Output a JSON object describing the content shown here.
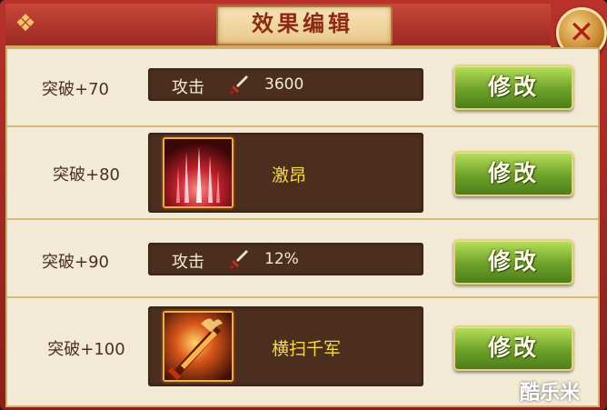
{
  "dialog": {
    "title": "效果编辑",
    "close_glyph": "✕",
    "corner_glyph": "❖"
  },
  "rows": [
    {
      "label": "突破+70",
      "kind": "stat",
      "attribute": "攻击",
      "icon": "sword-icon",
      "value": "3600",
      "button": "修改"
    },
    {
      "label": "突破+80",
      "kind": "skill",
      "skill_name": "激昂",
      "icon": "light-beams-skill-icon",
      "button": "修改"
    },
    {
      "label": "突破+90",
      "kind": "stat",
      "attribute": "攻击",
      "icon": "sword-icon",
      "value": "12%",
      "button": "修改"
    },
    {
      "label": "突破+100",
      "kind": "skill",
      "skill_name": "横扫千军",
      "icon": "flaming-sword-skill-icon",
      "button": "修改"
    }
  ],
  "watermark": "酷乐米",
  "colors": {
    "frame": "#9b2a22",
    "panel": "#f3ead6",
    "field": "#4c2e1e",
    "skill_name": "#f6d84a",
    "button_green": "#6ea22a"
  }
}
